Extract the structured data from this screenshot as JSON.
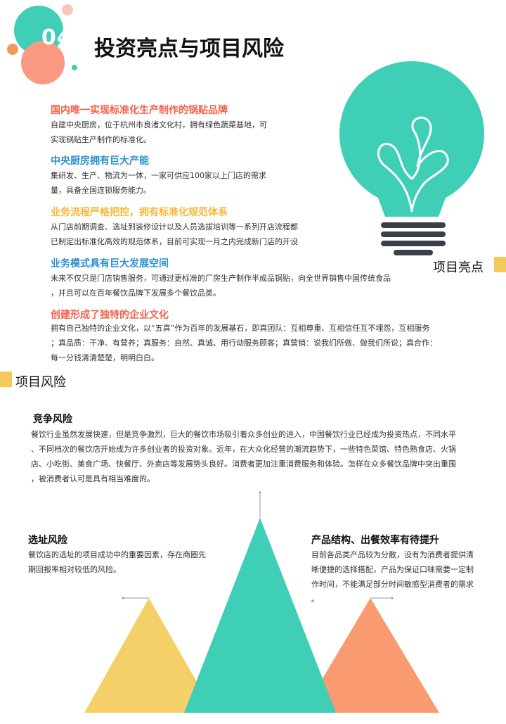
{
  "header": {
    "number": "04",
    "title": "投资亮点与项目风险"
  },
  "highlights": [
    {
      "title": "国内唯一实现标准化生产制作的锅贴品牌",
      "color": "#f5604a",
      "lines": [
        "自建中央厨房，位于杭州市良渚文化村，拥有绿色蔬菜基地，可",
        "实现锅贴生产制作的标准化。"
      ]
    },
    {
      "title": "中央厨房拥有巨大产能",
      "color": "#2b8fd0",
      "lines": [
        "集研发、生产、物流为一体，一家可供应100家以上门店的需求",
        "量，具备全国连锁服务能力。"
      ]
    },
    {
      "title": "业务流程严格把控，拥有标准化规范体系",
      "color": "#f5b93a",
      "lines": [
        "从门店前期调查、选址到装修设计以及人员选拔培训等一系列开店流程都",
        "已制定出标准化高效的规范体系，目前可实现一月之内完成新门店的开设"
      ]
    },
    {
      "title": "业务模式具有巨大发展空间",
      "color": "#2b8fd0",
      "lines": [
        "未来不仅只是门店销售服务，可通过更标准的厂房生产制作半成品锅贴，向全世界销售中国传统食品",
        "，并且可以在百年餐饮品牌下发展多个餐饮品类。"
      ]
    },
    {
      "title": "创建形成了独特的企业文化",
      "color": "#f5604a",
      "lines": [
        "拥有自己独特的企业文化，以“五真”作为百年的发展基石，即真团队：互相尊重、互相信任互不埋怨，互相服务",
        "；真品质：干净、有营养；真服务：自然、真诚、用行动服务顾客；真营销：说我们所做、做我们所说；真合作：",
        "每一分钱清清楚楚，明明白白。"
      ]
    }
  ],
  "highlights_label": "项目亮点",
  "risks_label": "项目风险",
  "risks": {
    "competition": {
      "title": "竞争风险",
      "lines": [
        "餐饮行业虽然发展快速，但是竞争激烈，巨大的餐饮市场吸引着众多创业的进入，中国餐饮行业已经成为投资热点，不同水平",
        "、不同档次的餐饮店开始成为许多创业者的投资对象。近年，在大众化经营的潮流趋势下，一些特色菜馆、特色熟食店、火锅",
        "店、小吃街、美食广场、快餐厅、外卖店等发展势头良好。消费者更加注重消费服务和体验。怎样在众多餐饮品牌中突出重围",
        "，被消费者认可是具有相当难度的。"
      ]
    },
    "location": {
      "title": "选址风险",
      "lines": [
        "餐饮店的选址的项目成功中的重要因素，存在商圈先",
        "期回报率相对较低的风险。"
      ]
    },
    "product": {
      "title": "产品结构、出餐效率有待提升",
      "lines": [
        "目前各品类产品较为分散，没有为消费者提供清",
        "晰便捷的选择搭配，产品为保证口味需要一定制",
        "作时间，不能满足部分时间敏感型消费者的需求",
        "。"
      ]
    }
  },
  "colors": {
    "teal": "#3ecfb6",
    "yellow": "#f5c85a",
    "salmon": "#fa9a70",
    "bulb_base": "#3a3f4a"
  },
  "icons": [
    "lightbulb-icon"
  ]
}
